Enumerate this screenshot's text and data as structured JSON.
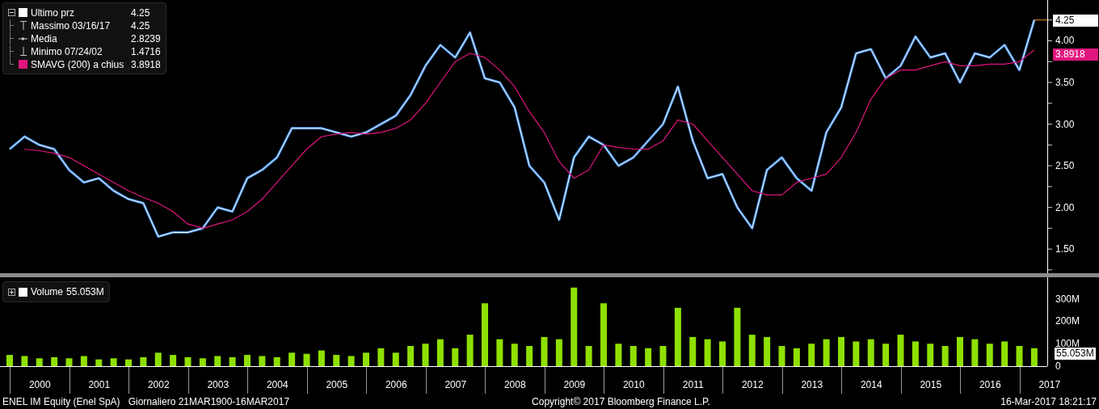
{
  "price_panel": {
    "legend": {
      "expanded": true,
      "items": [
        {
          "kind": "last",
          "value": "4.25",
          "color": "#ffffff"
        },
        {
          "kind": "high",
          "label": "Massimo 03/16/17",
          "value": "4.25"
        },
        {
          "kind": "mean",
          "label": "Media",
          "value": "2.8239"
        },
        {
          "kind": "low",
          "label": "Minimo 07/24/02",
          "value": "1.4716"
        },
        {
          "kind": "sma",
          "value": "3.8918",
          "color": "#e0157f"
        }
      ]
    },
    "callouts": [
      {
        "kind": "last",
        "text": "4.25"
      },
      {
        "kind": "sma",
        "text": "3.8918"
      }
    ],
    "chart_data": {
      "type": "line",
      "categories": [
        null,
        null,
        null,
        null,
        null,
        null,
        null,
        null,
        null,
        null,
        null,
        null,
        null,
        null,
        null,
        null,
        null,
        null,
        null,
        null,
        null,
        null,
        null,
        null,
        null,
        null,
        null,
        null,
        null,
        null,
        null,
        null,
        null,
        null,
        null,
        null,
        null,
        null,
        null,
        null,
        null,
        null,
        null,
        null,
        null,
        null,
        null,
        null,
        null,
        null,
        null,
        null,
        null,
        null,
        null,
        null,
        null,
        null,
        null,
        null,
        null,
        null,
        null,
        null,
        null,
        null,
        null,
        null,
        null,
        null
      ],
      "series": [
        {
          "name": "Ultimo prz",
          "color": "#ffffff",
          "values": [
            2.7,
            2.85,
            2.75,
            2.7,
            2.45,
            2.3,
            2.35,
            2.2,
            2.1,
            2.05,
            1.65,
            1.7,
            1.7,
            1.75,
            2.0,
            1.95,
            2.35,
            2.45,
            2.6,
            2.95,
            2.95,
            2.95,
            2.9,
            2.85,
            2.9,
            3.0,
            3.1,
            3.35,
            3.7,
            3.95,
            3.8,
            4.1,
            3.55,
            3.5,
            3.2,
            2.5,
            2.3,
            1.85,
            2.6,
            2.85,
            2.75,
            2.5,
            2.6,
            2.8,
            3.0,
            3.45,
            2.8,
            2.35,
            2.4,
            2.0,
            1.75,
            2.45,
            2.6,
            2.35,
            2.2,
            2.9,
            3.2,
            3.85,
            3.9,
            3.55,
            3.7,
            4.05,
            3.8,
            3.85,
            3.5,
            3.85,
            3.8,
            3.95,
            3.65,
            4.25
          ]
        },
        {
          "name": "SMAVG (200) a chius",
          "color": "#e0157f",
          "values": [
            null,
            2.7,
            2.68,
            2.65,
            2.6,
            2.5,
            2.4,
            2.3,
            2.2,
            2.12,
            2.05,
            1.95,
            1.8,
            1.75,
            1.8,
            1.85,
            1.95,
            2.1,
            2.3,
            2.5,
            2.7,
            2.85,
            2.88,
            2.9,
            2.88,
            2.9,
            2.95,
            3.05,
            3.25,
            3.5,
            3.75,
            3.85,
            3.8,
            3.65,
            3.45,
            3.15,
            2.9,
            2.55,
            2.35,
            2.45,
            2.75,
            2.72,
            2.7,
            2.7,
            2.8,
            3.05,
            3.0,
            2.8,
            2.6,
            2.4,
            2.2,
            2.15,
            2.15,
            2.3,
            2.35,
            2.4,
            2.6,
            2.9,
            3.3,
            3.55,
            3.65,
            3.65,
            3.7,
            3.75,
            3.7,
            3.7,
            3.72,
            3.72,
            3.75,
            3.89
          ]
        }
      ],
      "legend": "upper left",
      "ylim": [
        1.21,
        4.49
      ],
      "yticks": [
        {
          "value": 1.5,
          "label": "1.50"
        },
        {
          "value": 2,
          "label": "2.00"
        },
        {
          "value": 2.5,
          "label": "2.50"
        },
        {
          "value": 3,
          "label": "3.00"
        },
        {
          "value": 3.5,
          "label": "3.50"
        },
        {
          "value": 4,
          "label": "4.00"
        }
      ]
    }
  },
  "volume_panel": {
    "legend": {
      "expanded": false,
      "value": "55.053M",
      "color": "#ffffff"
    },
    "callout": "55.053M",
    "chart_data": {
      "type": "bar",
      "categories": [
        null,
        null,
        null,
        null,
        null,
        null,
        null,
        null,
        null,
        null,
        null,
        null,
        null,
        null,
        null,
        null,
        null,
        null,
        null,
        null,
        null,
        null,
        null,
        null,
        null,
        null,
        null,
        null,
        null,
        null,
        null,
        null,
        null,
        null,
        null,
        null,
        null,
        null,
        null,
        null,
        null,
        null,
        null,
        null,
        null,
        null,
        null,
        null,
        null,
        null,
        null,
        null,
        null,
        null,
        null,
        null,
        null,
        null,
        null,
        null,
        null,
        null,
        null,
        null,
        null,
        null,
        null,
        null,
        null,
        null
      ],
      "series": [
        {
          "name": "Volume",
          "color": "#8ee000",
          "values": [
            50,
            45,
            35,
            40,
            35,
            45,
            30,
            35,
            30,
            40,
            60,
            50,
            40,
            35,
            45,
            40,
            50,
            45,
            40,
            60,
            55,
            70,
            50,
            45,
            60,
            80,
            60,
            90,
            100,
            120,
            80,
            140,
            280,
            120,
            100,
            90,
            130,
            120,
            350,
            90,
            280,
            100,
            90,
            80,
            90,
            260,
            130,
            120,
            110,
            260,
            140,
            130,
            90,
            80,
            100,
            120,
            130,
            110,
            120,
            100,
            140,
            110,
            100,
            90,
            130,
            120,
            100,
            110,
            90,
            80
          ]
        }
      ],
      "legend": "upper left",
      "ylim": [
        0,
        396
      ],
      "yticks": [
        {
          "value": 0,
          "label": "0"
        },
        {
          "value": 100,
          "label": "100M"
        },
        {
          "value": 200,
          "label": "200M"
        },
        {
          "value": 300,
          "label": "300M"
        }
      ]
    }
  },
  "timeline": [
    "2000",
    "2001",
    "2002",
    "2003",
    "2004",
    "2005",
    "2006",
    "2007",
    "2008",
    "2009",
    "2010",
    "2011",
    "2012",
    "2013",
    "2014",
    "2015",
    "2016",
    "2017"
  ],
  "footer": {
    "security": "ENEL IM Equity (Enel SpA)",
    "range": "Giornaliero 21MAR1900-16MAR2017",
    "copyright": "Copyright© 2017 Bloomberg Finance L.P.",
    "timestamp": "16-Mar-2017 18:21:17"
  }
}
